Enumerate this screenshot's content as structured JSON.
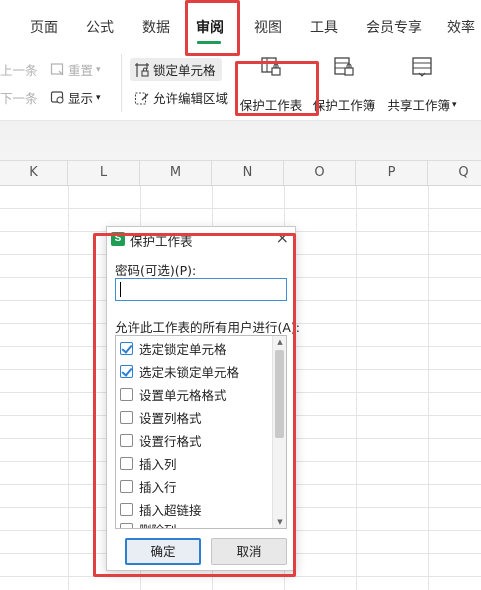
{
  "tabs": [
    {
      "label": "页面",
      "active": false
    },
    {
      "label": "公式",
      "active": false
    },
    {
      "label": "数据",
      "active": false
    },
    {
      "label": "审阅",
      "active": true
    },
    {
      "label": "视图",
      "active": false
    },
    {
      "label": "工具",
      "active": false
    },
    {
      "label": "会员专享",
      "active": false
    },
    {
      "label": "效率",
      "active": false
    }
  ],
  "ribbon": {
    "prev_label": "上一条",
    "next_label": "下一条",
    "reset_label": "重置",
    "show_label": "显示",
    "lock_cell_label": "锁定单元格",
    "allow_edit_label": "允许编辑区域",
    "protect_sheet_label": "保护工作表",
    "protect_workbook_label": "保护工作簿",
    "share_workbook_label": "共享工作簿"
  },
  "columns": [
    "K",
    "L",
    "M",
    "N",
    "O",
    "P",
    "Q"
  ],
  "dialog": {
    "app_badge": "S",
    "title": "保护工作表",
    "close": "×",
    "password_label": "密码(可选)(P):",
    "password_value": "",
    "allow_label": "允许此工作表的所有用户进行(A):",
    "options": [
      {
        "label": "选定锁定单元格",
        "checked": true
      },
      {
        "label": "选定未锁定单元格",
        "checked": true
      },
      {
        "label": "设置单元格格式",
        "checked": false
      },
      {
        "label": "设置列格式",
        "checked": false
      },
      {
        "label": "设置行格式",
        "checked": false
      },
      {
        "label": "插入列",
        "checked": false
      },
      {
        "label": "插入行",
        "checked": false
      },
      {
        "label": "插入超链接",
        "checked": false
      },
      {
        "label": "删除列",
        "checked": false
      }
    ],
    "ok_label": "确定",
    "cancel_label": "取消"
  },
  "colors": {
    "accent_green": "#1f9d55",
    "highlight_red": "#e0403f",
    "focus_blue": "#2d7fd2"
  }
}
